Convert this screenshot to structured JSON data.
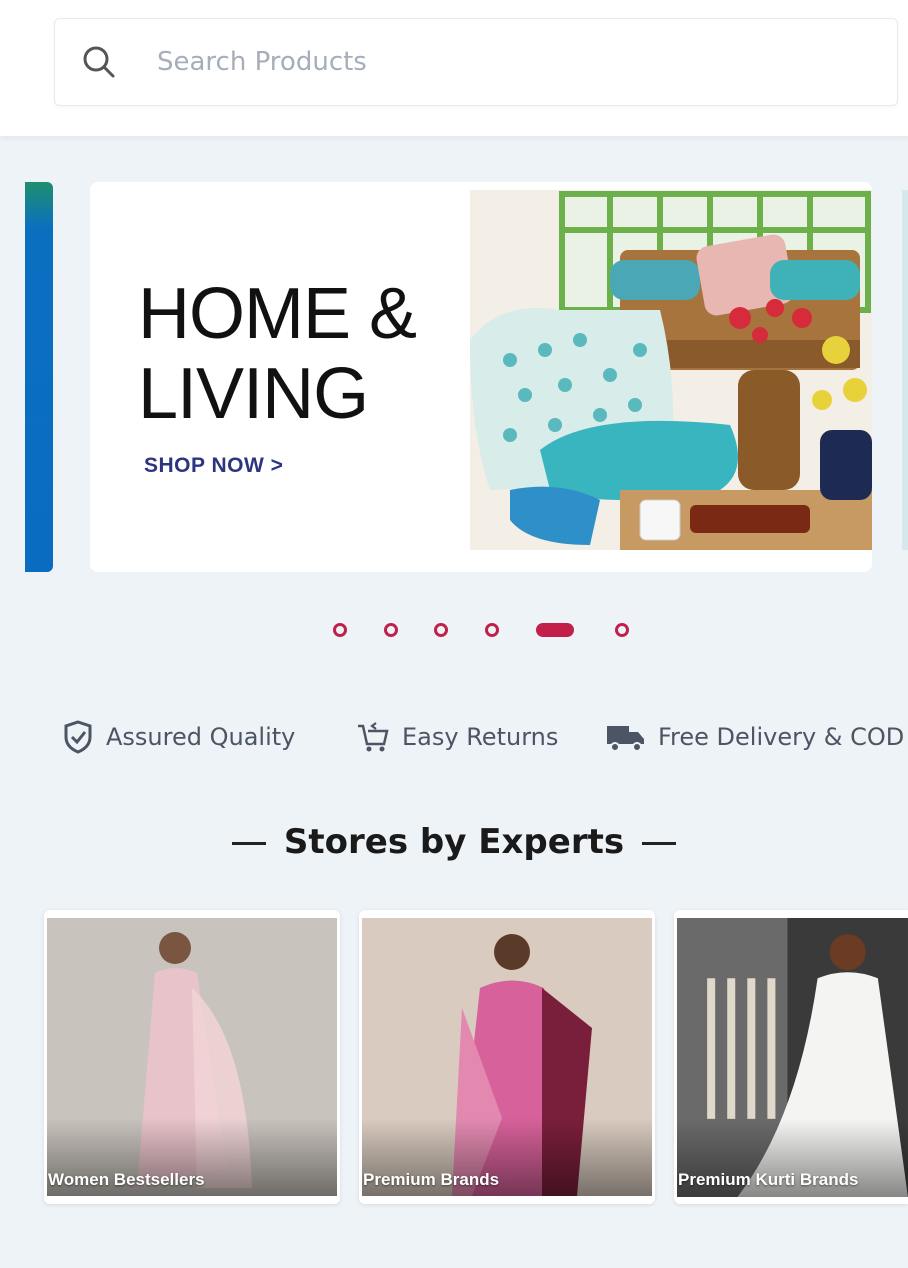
{
  "search": {
    "placeholder": "Search Products",
    "icon": "search-icon"
  },
  "banner": {
    "title_line1": "HOME &",
    "title_line2": "LIVING",
    "cta": "SHOP NOW >",
    "cta_color": "#2d3580",
    "carousel": {
      "total": 6,
      "active_index": 4,
      "active_color": "#c2204a"
    }
  },
  "features": [
    {
      "label": "Assured Quality",
      "icon": "shield-check-icon"
    },
    {
      "label": "Easy Returns",
      "icon": "cart-return-icon"
    },
    {
      "label": "Free Delivery & COD",
      "icon": "delivery-truck-icon"
    }
  ],
  "stores_section": {
    "title": "Stores by Experts",
    "stores": [
      {
        "label": "Women Bestsellers"
      },
      {
        "label": "Premium Brands"
      },
      {
        "label": "Premium Kurti Brands"
      }
    ]
  }
}
